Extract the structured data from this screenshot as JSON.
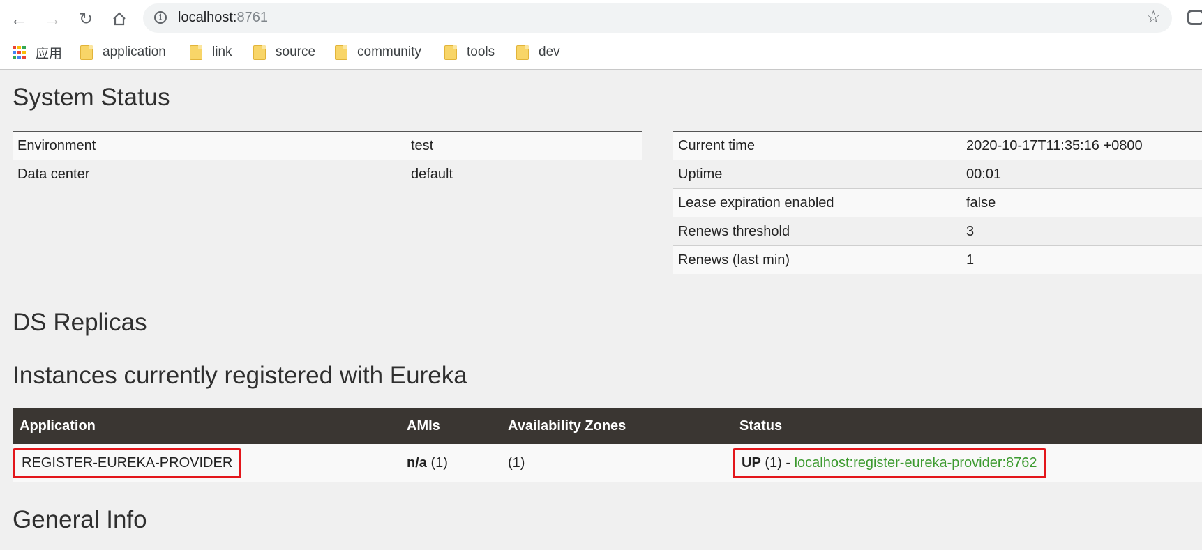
{
  "browser": {
    "url_host": "localhost:",
    "url_port": "8761",
    "info_icon": "info-icon",
    "star_icon": "star-icon"
  },
  "bookmarks": {
    "apps_label": "应用",
    "items": [
      {
        "label": "application"
      },
      {
        "label": "link"
      },
      {
        "label": "source"
      },
      {
        "label": "community"
      },
      {
        "label": "tools"
      },
      {
        "label": "dev"
      }
    ]
  },
  "system_status": {
    "title": "System Status",
    "left": [
      {
        "key": "Environment",
        "value": "test"
      },
      {
        "key": "Data center",
        "value": "default"
      }
    ],
    "right": [
      {
        "key": "Current time",
        "value": "2020-10-17T11:35:16 +0800"
      },
      {
        "key": "Uptime",
        "value": "00:01"
      },
      {
        "key": "Lease expiration enabled",
        "value": "false"
      },
      {
        "key": "Renews threshold",
        "value": "3"
      },
      {
        "key": "Renews (last min)",
        "value": "1"
      }
    ]
  },
  "ds_replicas": {
    "title": "DS Replicas"
  },
  "instances": {
    "title": "Instances currently registered with Eureka",
    "headers": [
      "Application",
      "AMIs",
      "Availability Zones",
      "Status"
    ],
    "rows": [
      {
        "application": "REGISTER-EUREKA-PROVIDER",
        "amis_bold": "n/a",
        "amis_count": " (1)",
        "zones": "(1)",
        "status_bold": "UP",
        "status_count": " (1) - ",
        "status_link": "localhost:register-eureka-provider:8762"
      }
    ]
  },
  "general_info": {
    "title": "General Info"
  },
  "colors": {
    "header_bg": "#3a3632",
    "link_green": "#3c9a2f",
    "highlight_red": "#e3161b"
  }
}
